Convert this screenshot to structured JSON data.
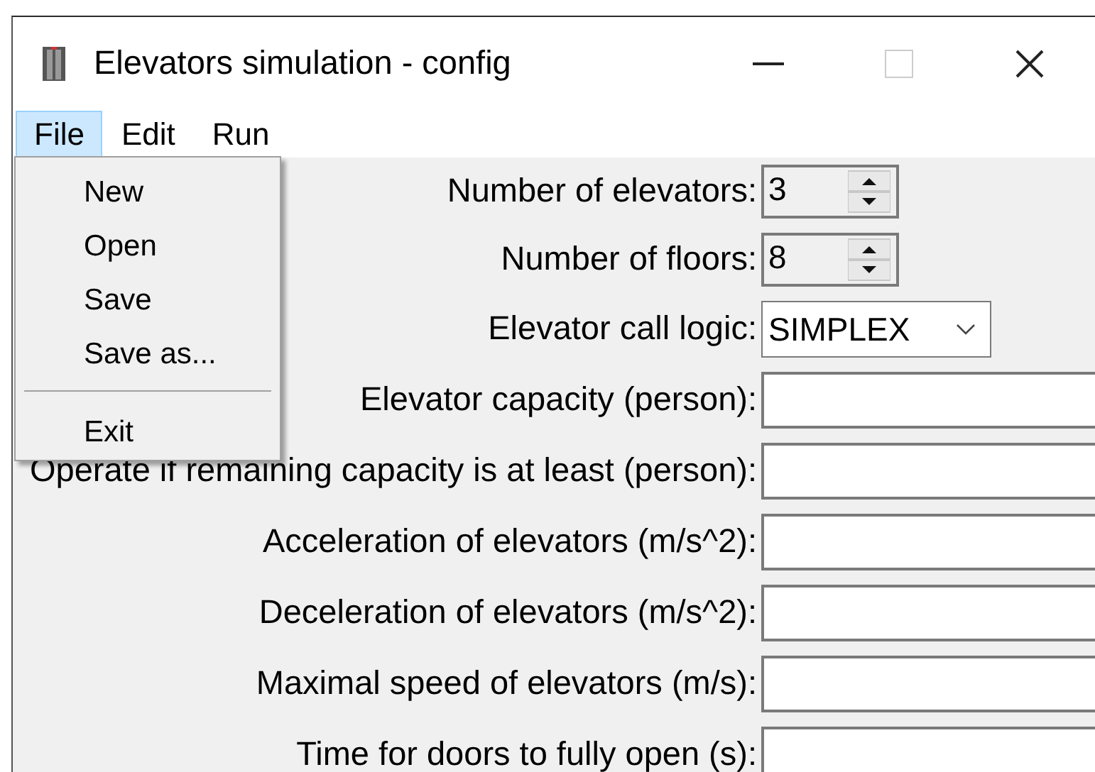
{
  "window": {
    "title": "Elevators simulation - config"
  },
  "menu_bar": [
    {
      "label": "File",
      "selected": true
    },
    {
      "label": "Edit",
      "selected": false
    },
    {
      "label": "Run",
      "selected": false
    }
  ],
  "file_menu": [
    {
      "kind": "item",
      "label": "New"
    },
    {
      "kind": "item",
      "label": "Open"
    },
    {
      "kind": "item",
      "label": "Save"
    },
    {
      "kind": "item",
      "label": "Save as..."
    },
    {
      "kind": "separator"
    },
    {
      "kind": "item",
      "label": "Exit"
    }
  ],
  "fields": [
    {
      "kind": "spin",
      "label": "Number of elevators:",
      "value": "3"
    },
    {
      "kind": "spin",
      "label": "Number of floors:",
      "value": "8"
    },
    {
      "kind": "combo",
      "label": "Elevator call logic:",
      "value": "SIMPLEX"
    },
    {
      "kind": "text",
      "label": "Elevator capacity (person):"
    },
    {
      "kind": "text",
      "label": "Operate if remaining capacity is at least (person):"
    },
    {
      "kind": "text",
      "label": "Acceleration of elevators (m/s^2):"
    },
    {
      "kind": "text",
      "label": "Deceleration of elevators (m/s^2):"
    },
    {
      "kind": "text",
      "label": "Maximal speed of elevators (m/s):"
    },
    {
      "kind": "text",
      "label": "Time for doors to fully open (s):"
    }
  ]
}
